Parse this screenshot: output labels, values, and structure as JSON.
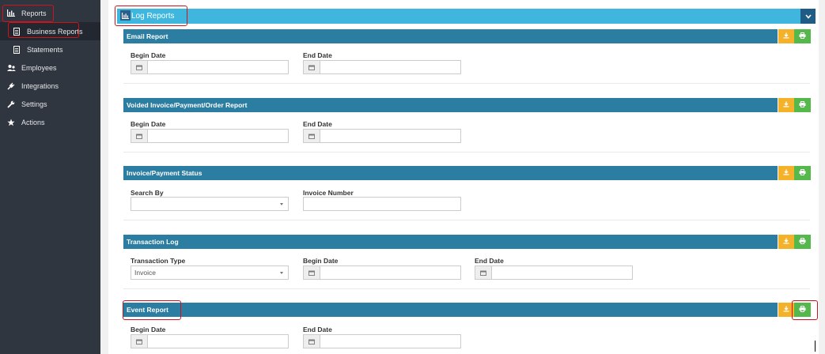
{
  "sidebar": {
    "items": [
      {
        "label": "Reports",
        "icon": "bar-chart-icon"
      },
      {
        "label": "Business Reports",
        "icon": "document-icon"
      },
      {
        "label": "Statements",
        "icon": "document-icon"
      },
      {
        "label": "Employees",
        "icon": "users-icon"
      },
      {
        "label": "Integrations",
        "icon": "plug-icon"
      },
      {
        "label": "Settings",
        "icon": "wrench-icon"
      },
      {
        "label": "Actions",
        "icon": "star-icon"
      }
    ]
  },
  "header": {
    "title": "Log Reports",
    "icon": "bar-chart-icon",
    "collapse_icon": "chevron-down-icon"
  },
  "sections": {
    "email": {
      "title": "Email Report",
      "begin_label": "Begin Date",
      "end_label": "End Date"
    },
    "voided": {
      "title": "Voided Invoice/Payment/Order Report",
      "begin_label": "Begin Date",
      "end_label": "End Date"
    },
    "status": {
      "title": "Invoice/Payment Status",
      "search_label": "Search By",
      "search_value": "",
      "invoice_label": "Invoice Number",
      "invoice_value": ""
    },
    "transaction": {
      "title": "Transaction Log",
      "type_label": "Transaction Type",
      "type_value": "Invoice",
      "begin_label": "Begin Date",
      "end_label": "End Date"
    },
    "event": {
      "title": "Event Report",
      "begin_label": "Begin Date",
      "end_label": "End Date"
    }
  },
  "colors": {
    "sidebar_bg": "#2f3640",
    "header_bar": "#3fb6dd",
    "section_header": "#2b7da1",
    "download_button": "#f3b22a",
    "print_button": "#55b84a",
    "highlight": "#d0121b"
  }
}
